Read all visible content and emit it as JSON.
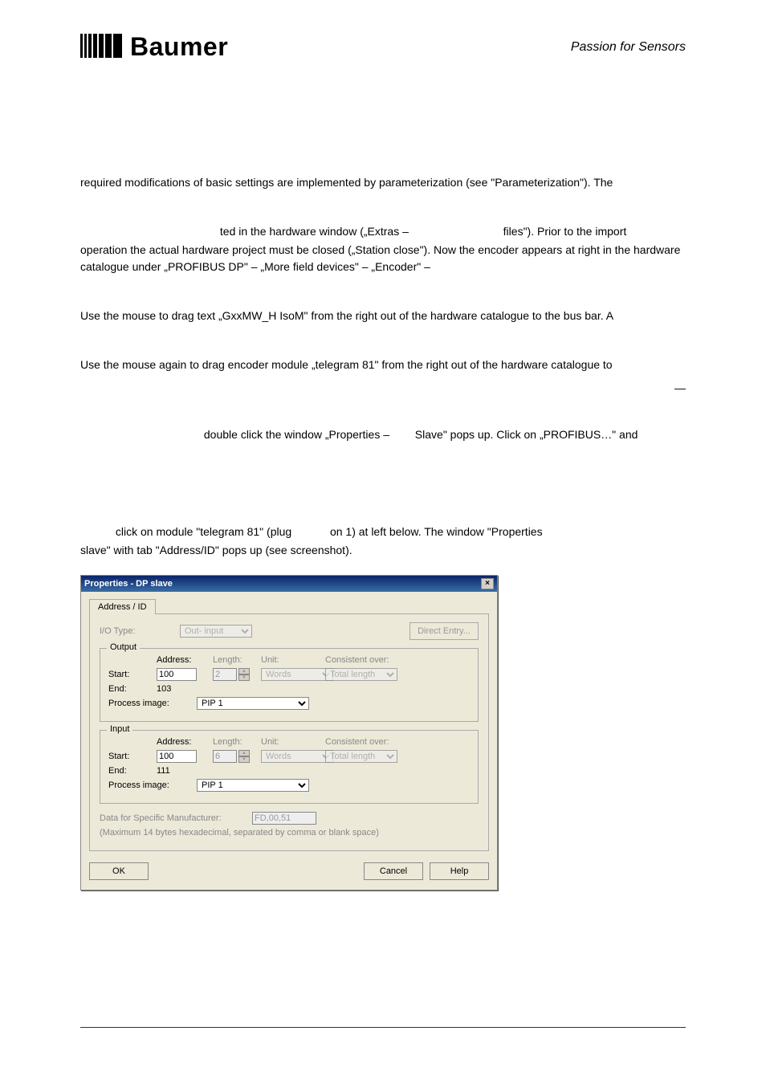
{
  "brand": {
    "logo_text": "Baumer",
    "tagline": "Passion for Sensors"
  },
  "paragraphs": {
    "p1": "required modifications of basic settings are implemented by parameterization (see \"Parameterization\"). The",
    "p2_a": "ted in the hardware window („Extras –",
    "p2_b": "files\"). Prior to the import",
    "p3": "operation the actual hardware project must be closed („Station   close\"). Now the encoder appears at right in the hardware catalogue under „PROFIBUS DP\" – „More field devices\" – „Encoder\" –",
    "p4": "Use the mouse to drag text „GxxMW_H IsoM\" from the right out of the hardware catalogue to the bus bar. A",
    "p5": "Use the mouse again to drag encoder module „telegram 81\" from the right out of the hardware catalogue to",
    "p6_a": "double click the window „Properties –",
    "p6_b": "Slave\" pops up. Click on „PROFIBUS…\" and",
    "p7_a": "click on module \"telegram 81\" (plug",
    "p7_b": "on 1) at left below. The window \"Properties",
    "p8": "slave\" with tab \"Address/ID\" pops up (see screenshot)."
  },
  "dialog": {
    "title": "Properties - DP slave",
    "close_glyph": "×",
    "tab": "Address / ID",
    "io_type_label": "I/O Type:",
    "io_type_value": "Out- input",
    "direct_entry": "Direct Entry...",
    "output": {
      "group_title": "Output",
      "hdr_address": "Address:",
      "hdr_length": "Length:",
      "hdr_unit": "Unit:",
      "hdr_consistent": "Consistent over:",
      "start_label": "Start:",
      "start_value": "100",
      "length_value": "2",
      "unit_value": "Words",
      "consistent_value": "Total length",
      "end_label": "End:",
      "end_value": "103",
      "process_image_label": "Process image:",
      "process_image_value": "PIP 1"
    },
    "input": {
      "group_title": "Input",
      "hdr_address": "Address:",
      "hdr_length": "Length:",
      "hdr_unit": "Unit:",
      "hdr_consistent": "Consistent over:",
      "start_label": "Start:",
      "start_value": "100",
      "length_value": "6",
      "unit_value": "Words",
      "consistent_value": "Total length",
      "end_label": "End:",
      "end_value": "111",
      "process_image_label": "Process image:",
      "process_image_value": "PIP 1"
    },
    "mfr_label": "Data for Specific Manufacturer:",
    "mfr_value": "FD,00,51",
    "mfr_note": "(Maximum 14 bytes hexadecimal, separated by comma or blank space)",
    "ok": "OK",
    "cancel": "Cancel",
    "help": "Help"
  }
}
